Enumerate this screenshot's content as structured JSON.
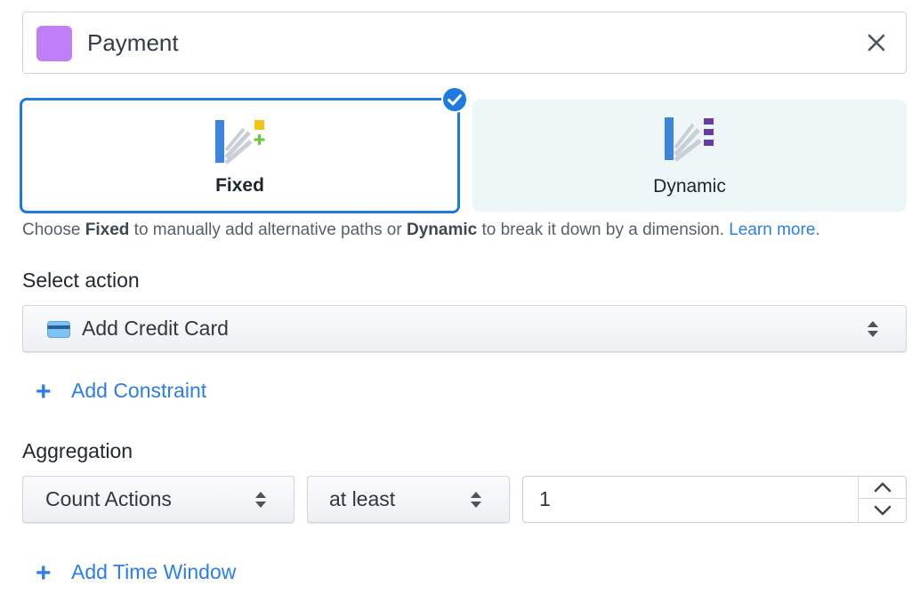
{
  "step": {
    "name": "Payment",
    "color": "#c17ff7"
  },
  "modes": {
    "fixed_label": "Fixed",
    "dynamic_label": "Dynamic",
    "selected": "Fixed",
    "accent": "#1f7ae0"
  },
  "help": {
    "prefix": "Choose ",
    "fixed_word": "Fixed",
    "middle": " to manually add alternative paths or ",
    "dynamic_word": "Dynamic",
    "suffix": " to break it down by a dimension.",
    "link": "Learn more."
  },
  "action": {
    "section_label": "Select action",
    "selected": "Add Credit Card",
    "icon": "credit-card-icon",
    "add_constraint": "Add Constraint"
  },
  "aggregation": {
    "section_label": "Aggregation",
    "function": "Count Actions",
    "operator": "at least",
    "value": "1",
    "add_time_window": "Add Time Window"
  }
}
